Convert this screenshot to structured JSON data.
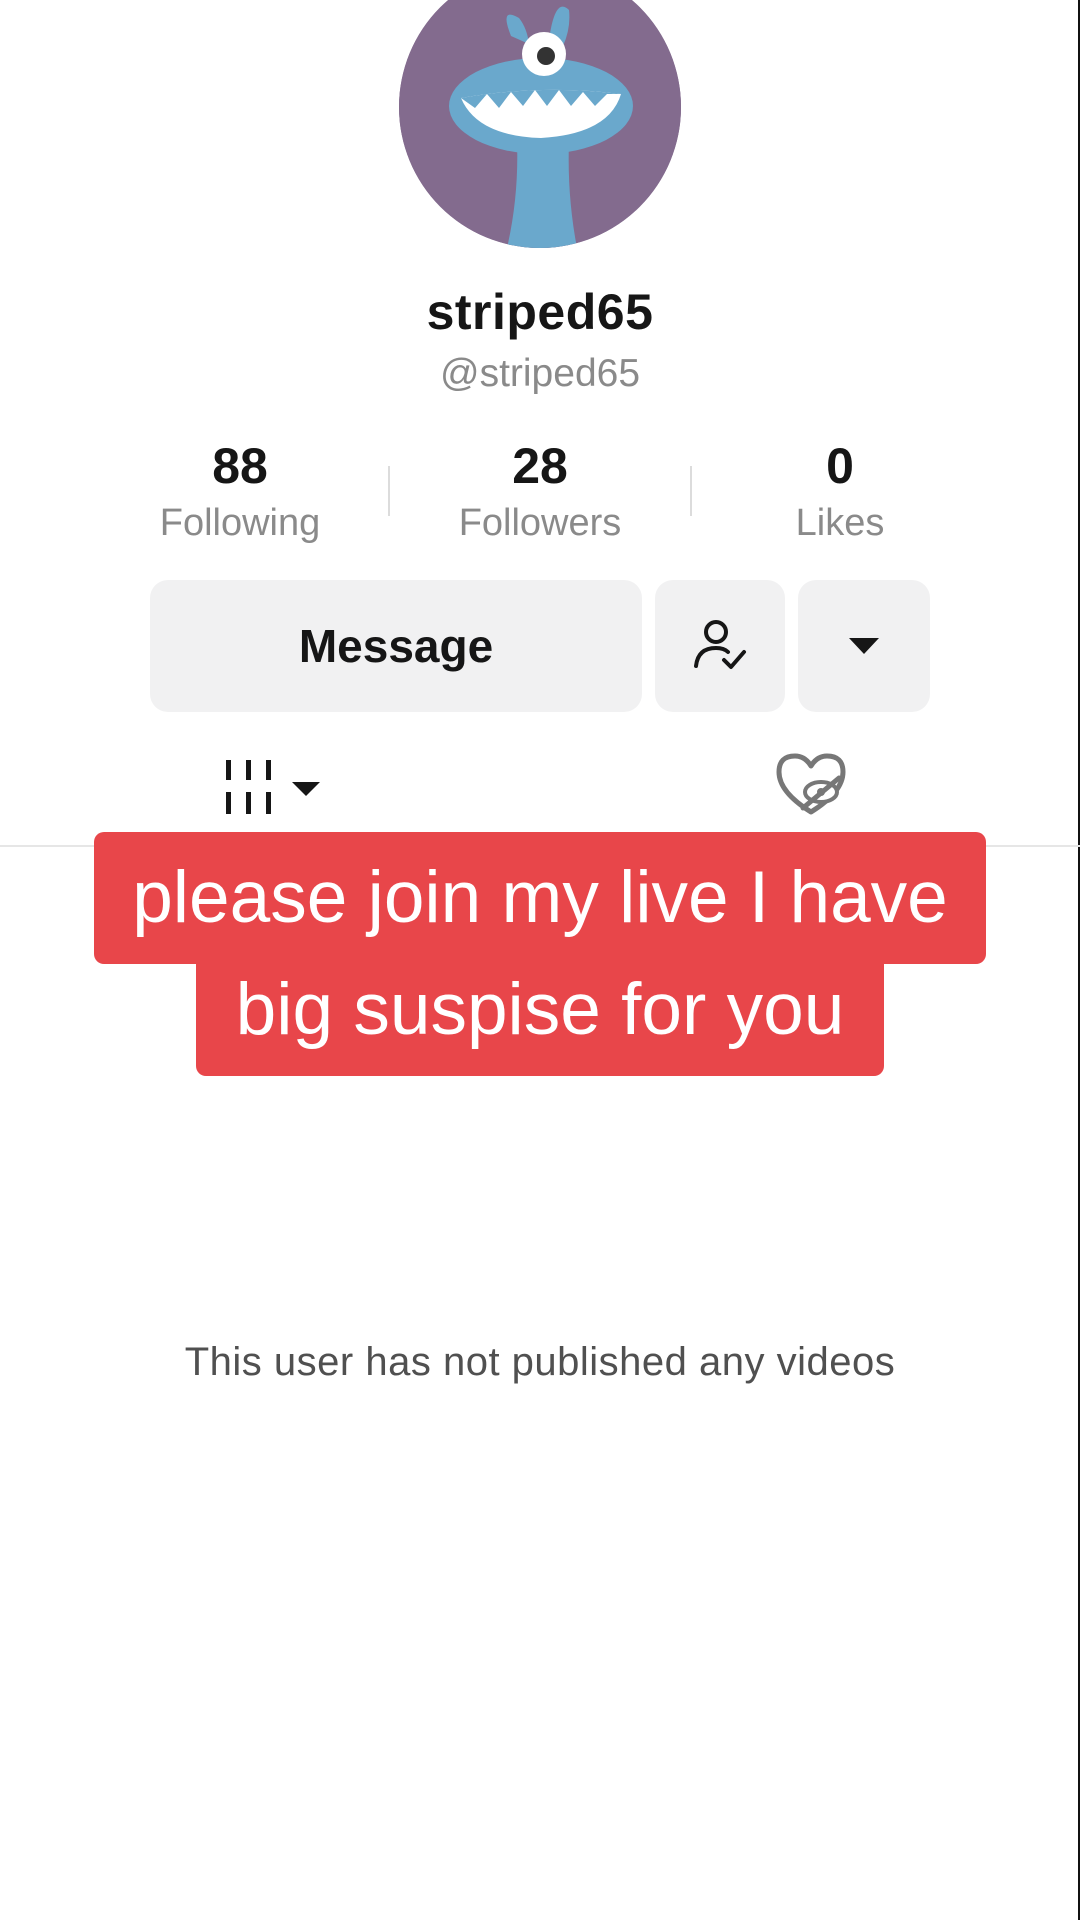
{
  "profile": {
    "display_name": "striped65",
    "handle": "@striped65",
    "avatar_icon": "blue-monster-avatar"
  },
  "stats": [
    {
      "value": "88",
      "label": "Following"
    },
    {
      "value": "28",
      "label": "Followers"
    },
    {
      "value": "0",
      "label": "Likes"
    }
  ],
  "actions": {
    "message_label": "Message",
    "followed_icon": "person-check-icon",
    "more_icon": "caret-down-icon"
  },
  "tabs": {
    "videos_icon": "grid-dropdown-icon",
    "liked_icon": "hidden-heart-icon"
  },
  "overlay": {
    "line1": "please join my live I have",
    "line2": "big suspise for you",
    "bg_color": "#e8464a"
  },
  "empty_state": "This user has not published any videos"
}
